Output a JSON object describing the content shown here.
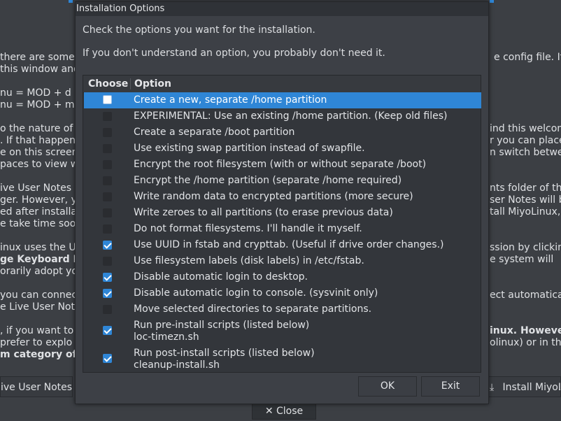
{
  "background": {
    "lines": [
      {
        "t": "there are some c"
      },
      {
        "t": "this window and"
      },
      {
        "t": "nu = MOD + d  ("
      },
      {
        "t": "nu = MOD + m"
      },
      {
        "t": "o the nature of i"
      },
      {
        "t": ". If that happen"
      },
      {
        "t": "e on this screen"
      },
      {
        "t": "paces to view w"
      },
      {
        "t": "ive User Notes a"
      },
      {
        "t": "ger. However, y"
      },
      {
        "t": "ed after installat"
      },
      {
        "t": "e take time soon"
      },
      {
        "t": "inux uses the US"
      },
      {
        "t": "ge Keyboard La"
      },
      {
        "t": "orarily adopt you"
      },
      {
        "t": "you can connect"
      },
      {
        "t": "e Live User Note"
      },
      {
        "t": ", if you want to"
      },
      {
        "t": " prefer to explo"
      },
      {
        "t": "m category of P"
      }
    ],
    "right_lines": [
      {
        "t": "e config file. If y"
      },
      {
        "t": "ind this welcom"
      },
      {
        "t": "r you can place"
      },
      {
        "t": "n switch betwe"
      },
      {
        "t": "nts folder of th"
      },
      {
        "t": "ser Notes will b"
      },
      {
        "t": "tall MiyoLinux,"
      },
      {
        "t": "ssion by clickin"
      },
      {
        "t": "e system will"
      },
      {
        "t": "ect automatical"
      },
      {
        "t": "inux. However,"
      },
      {
        "t": "olinux) or in the"
      }
    ],
    "live_notes_button": "ive User Notes",
    "install_button": "Install MiyoL",
    "close_button": "✕ Close"
  },
  "dialog": {
    "title": "Installation Options",
    "message1": "Check the options you want for the installation.",
    "message2": "If you don't understand an option, you probably don't need it.",
    "col_choose": "Choose",
    "col_option": "Option",
    "options": [
      {
        "label": "Create a new, separate /home partition",
        "checked": false
      },
      {
        "label": "EXPERIMENTAL: Use an existing /home partition. (Keep old files)",
        "checked": false
      },
      {
        "label": "Create a separate /boot partition",
        "checked": false
      },
      {
        "label": "Use existing swap partition instead of swapfile.",
        "checked": false
      },
      {
        "label": "Encrypt the root filesystem (with or without separate /boot)",
        "checked": false
      },
      {
        "label": "Encrypt the /home partition (separate /home required)",
        "checked": false
      },
      {
        "label": "Write random data to encrypted partitions (more secure)",
        "checked": false
      },
      {
        "label": "Write zeroes to all partitions (to erase previous data)",
        "checked": false
      },
      {
        "label": "Do not format filesystems. I'll handle it myself.",
        "checked": false
      },
      {
        "label": "Use UUID in fstab and crypttab. (Useful if drive order changes.)",
        "checked": true
      },
      {
        "label": "Use filesystem labels (disk labels) in /etc/fstab.",
        "checked": false
      },
      {
        "label": "Disable automatic login to desktop.",
        "checked": true
      },
      {
        "label": "Disable automatic login to console. (sysvinit only)",
        "checked": true
      },
      {
        "label": "Move selected directories to separate partitions.",
        "checked": false
      },
      {
        "label": "Run pre-install scripts (listed below)",
        "sub": "loc-timezn.sh",
        "checked": true
      },
      {
        "label": "Run post-install scripts (listed below)",
        "sub": "cleanup-install.sh",
        "checked": true
      }
    ],
    "ok": "OK",
    "exit": "Exit"
  }
}
